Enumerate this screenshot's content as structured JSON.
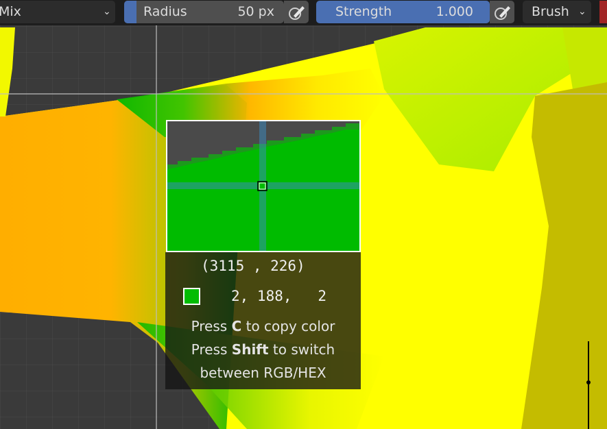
{
  "toolbar": {
    "blend_mode": "Mix",
    "radius": {
      "label": "Radius",
      "value": "50 px"
    },
    "strength": {
      "label": "Strength",
      "value": "1.000"
    },
    "brush_menu": "Brush",
    "icons": [
      "chevron-down-icon",
      "pen-pressure-icon"
    ]
  },
  "color_picker": {
    "coords": "(3115 , 226)",
    "rgb": "2, 188,   2",
    "swatch_color": "#02bc02",
    "hint_line1_pre": "Press ",
    "hint_line1_key": "C",
    "hint_line1_post": " to copy color",
    "hint_line2_pre": "Press ",
    "hint_line2_key": "Shift",
    "hint_line2_post": " to switch",
    "hint_line3": "between RGB/HEX"
  },
  "colors": {
    "accent_blue": "#4a6fb2",
    "mesh_green": "#02bc02",
    "mesh_yellow": "#ffff00",
    "mesh_orange": "#ffb000",
    "mesh_olive": "#c4bc00"
  }
}
